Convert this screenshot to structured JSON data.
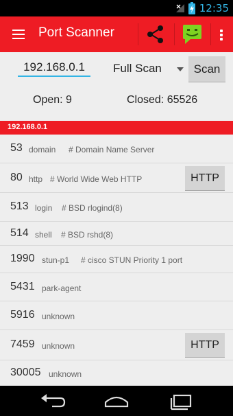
{
  "status_bar": {
    "time": "12:35",
    "icons": [
      "no-signal-icon",
      "battery-charging-icon"
    ]
  },
  "app_bar": {
    "title": "Port Scanner",
    "actions": [
      "menu-icon",
      "share-icon",
      "message-icon",
      "overflow-icon"
    ]
  },
  "scan_form": {
    "ip_value": "192.168.0.1",
    "scan_type": "Full Scan",
    "scan_button": "Scan"
  },
  "stats": {
    "open": "Open: 9",
    "closed": "Closed: 65526"
  },
  "host": "192.168.0.1",
  "ports": [
    {
      "port": "53",
      "service": "domain",
      "desc": "# Domain Name Server",
      "button": ""
    },
    {
      "port": "80",
      "service": "http",
      "desc": "# World Wide Web HTTP",
      "button": "HTTP"
    },
    {
      "port": "513",
      "service": "login",
      "desc": "# BSD rlogind(8)",
      "button": ""
    },
    {
      "port": "514",
      "service": "shell",
      "desc": "# BSD rshd(8)",
      "button": ""
    },
    {
      "port": "1990",
      "service": "stun-p1",
      "desc": "# cisco STUN Priority 1 port",
      "button": ""
    },
    {
      "port": "5431",
      "service": "park-agent",
      "desc": "",
      "button": ""
    },
    {
      "port": "5916",
      "service": "unknown",
      "desc": "",
      "button": ""
    },
    {
      "port": "7459",
      "service": "unknown",
      "desc": "",
      "button": "HTTP"
    },
    {
      "port": "30005",
      "service": "unknown",
      "desc": "",
      "button": ""
    }
  ],
  "nav_bar": {
    "buttons": [
      "back-icon",
      "home-icon",
      "recents-icon"
    ]
  },
  "colors": {
    "accent": "#ee1c24",
    "input_underline": "#33b5e5",
    "background": "#eeeeee"
  }
}
